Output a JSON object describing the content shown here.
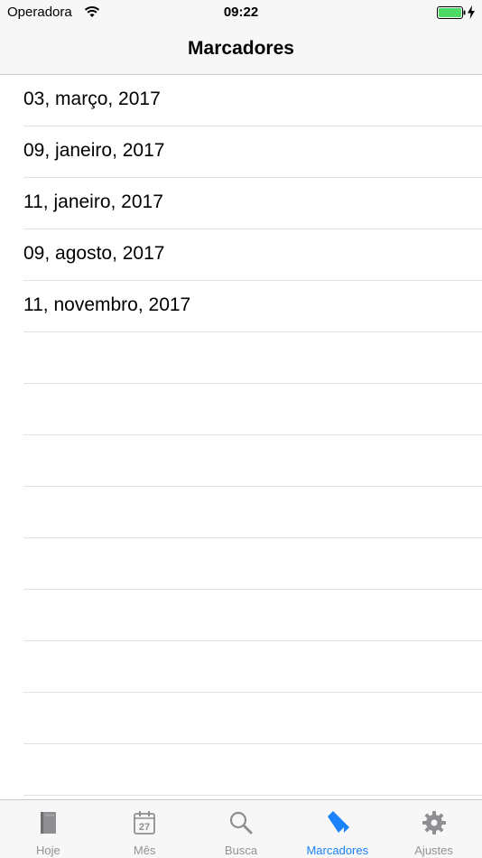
{
  "status_bar": {
    "carrier": "Operadora",
    "time": "09:22",
    "wifi_icon": "wifi-icon",
    "battery_icon": "battery-icon",
    "battery_color": "#4cd964"
  },
  "nav": {
    "title": "Marcadores"
  },
  "bookmarks": [
    {
      "label": "03, março, 2017"
    },
    {
      "label": "09, janeiro, 2017"
    },
    {
      "label": "11, janeiro, 2017"
    },
    {
      "label": "09, agosto, 2017"
    },
    {
      "label": "11, novembro, 2017"
    }
  ],
  "tabs": [
    {
      "label": "Hoje",
      "icon": "book-icon",
      "active": false
    },
    {
      "label": "Mês",
      "icon": "calendar-icon",
      "calendar_day": "27",
      "active": false
    },
    {
      "label": "Busca",
      "icon": "search-icon",
      "active": false
    },
    {
      "label": "Marcadores",
      "icon": "bookmark-icon",
      "active": true
    },
    {
      "label": "Ajustes",
      "icon": "gear-icon",
      "active": false
    }
  ],
  "colors": {
    "accent": "#1a82fb",
    "inactive": "#929292",
    "bar_background": "#f7f7f7",
    "separator": "#e0e0e0"
  }
}
